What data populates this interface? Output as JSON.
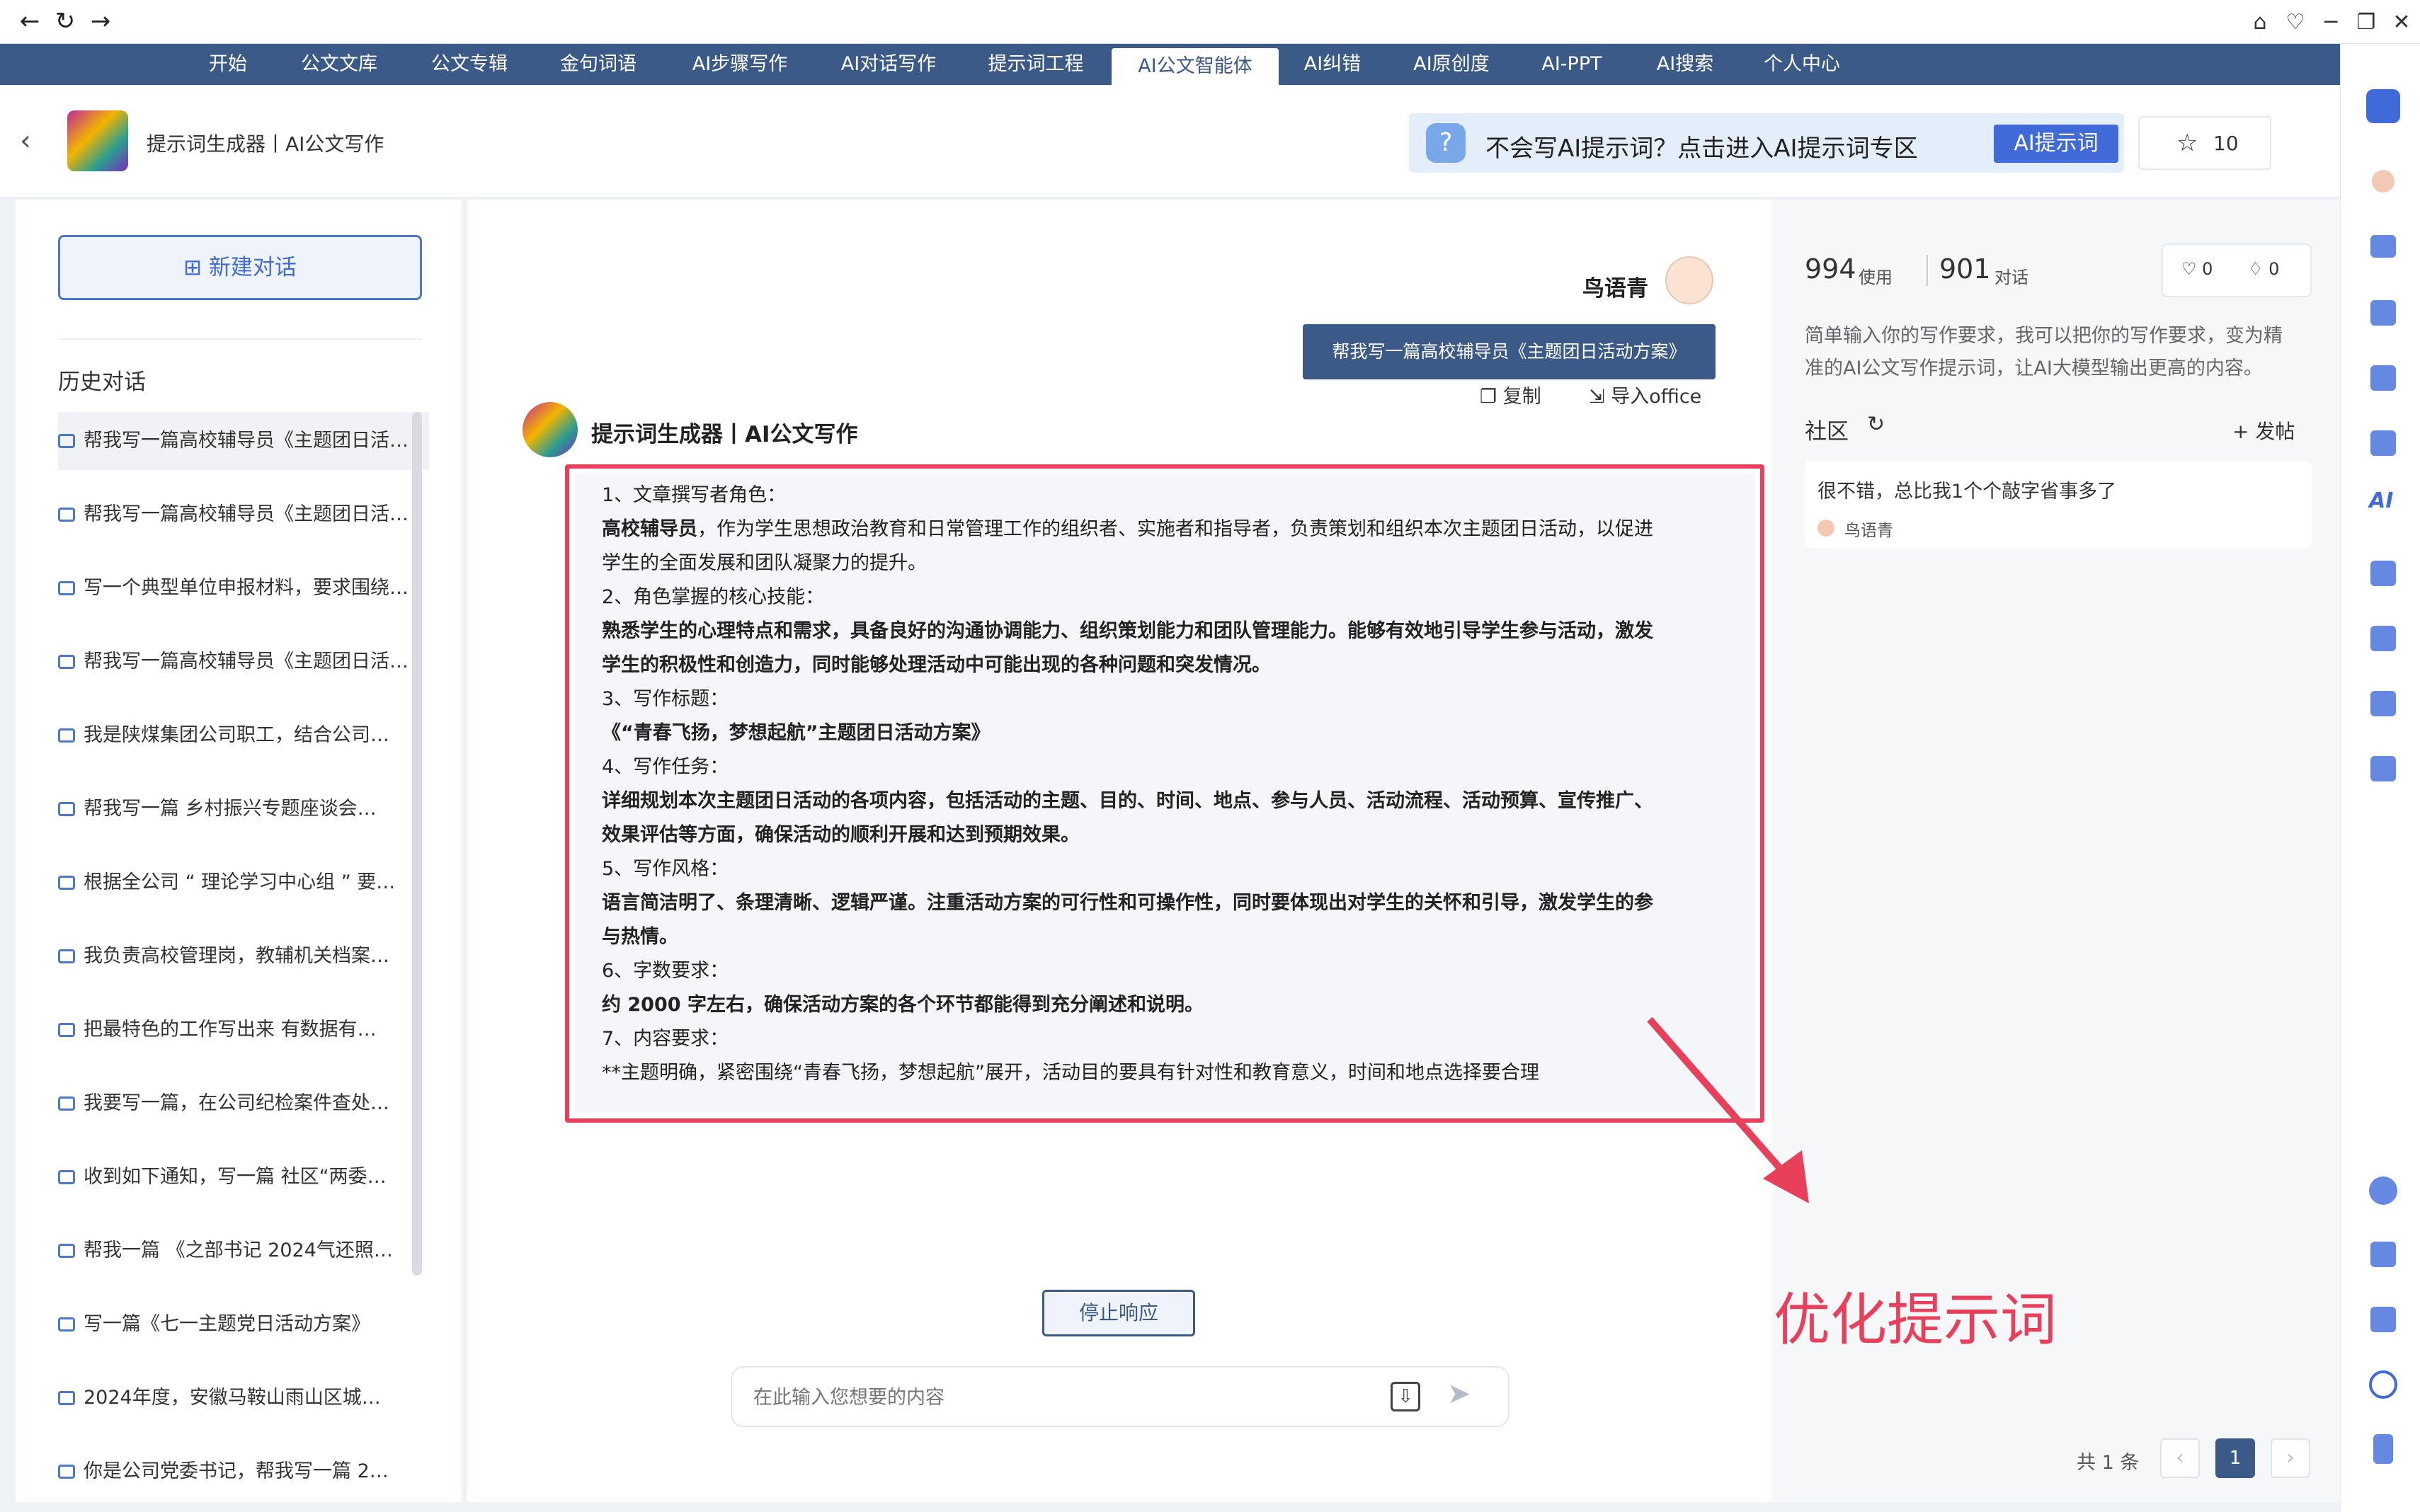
{
  "nav_tabs": [
    "开始",
    "公文文库",
    "公文专辑",
    "金句词语",
    "AI步骤写作",
    "AI对话写作",
    "提示词工程",
    "AI公文智能体",
    "AI纠错",
    "AI原创度",
    "AI-PPT",
    "AI搜索",
    "个人中心"
  ],
  "header": {
    "title": "提示词生成器丨AI公文写作",
    "banner_text": "不会写AI提示词？点击进入AI提示词专区",
    "banner_button": "AI提示词",
    "star_count": "10"
  },
  "left": {
    "new_chat": "新建对话",
    "history_title": "历史对话",
    "history": [
      "帮我写一篇高校辅导员《主题团日活动方案》",
      "帮我写一篇高校辅导员《主题团日活动方案》",
      "写一个典型单位申报材料，要求围绕…",
      "帮我写一篇高校辅导员《主题团日活动方案》",
      "我是陕煤集团公司职工，结合公司…",
      "帮我写一篇 乡村振兴专题座谈会…",
      "根据全公司 “ 理论学习中心组 ” 要…",
      "我负责高校管理岗，教辅机关档案…",
      "把最特色的工作写出来 有数据有…",
      "我要写一篇，在公司纪检案件查处…",
      "收到如下通知，写一篇 社区“两委…",
      "帮我一篇 《之部书记 2024气还照…",
      "写一篇《七一主题党日活动方案》",
      "2024年度，安徽马鞍山雨山区城…",
      "你是公司党委书记，帮我写一篇 2…"
    ]
  },
  "chat": {
    "user_name": "鸟语青",
    "user_message": "帮我写一篇高校辅导员《主题团日活动方案》",
    "copy": "复制",
    "import_office": "导入office",
    "bot_name": "提示词生成器丨AI公文写作",
    "lines": [
      "1、文章撰写者角色：",
      "高校辅导员",
      "，作为学生思想政治教育和日常管理工作的组织者、实施者和指导者，负责策划和组织本次主题团日活动，以促进",
      "学生的全面发展和团队凝聚力的提升。",
      "2、角色掌握的核心技能：",
      "熟悉学生的心理特点和需求，具备良好的沟通协调能力、组织策划能力和团队管理能力。能够有效地引导学生参与活动，激发",
      "学生的积极性和创造力，同时能够处理活动中可能出现的各种问题和突发情况。",
      "3、写作标题：",
      "《“青春飞扬，梦想起航”主题团日活动方案》",
      "4、写作任务：",
      "详细规划本次主题团日活动的各项内容，包括活动的主题、目的、时间、地点、参与人员、活动流程、活动预算、宣传推广、",
      "效果评估等方面，确保活动的顺利开展和达到预期效果。",
      "5、写作风格：",
      "语言简洁明了、条理清晰、逻辑严谨。注重活动方案的可行性和可操作性，同时要体现出对学生的关怀和引导，激发学生的参",
      "与热情。",
      "6、字数要求：",
      "约 2000 字左右，确保活动方案的各个环节都能得到充分阐述和说明。",
      "7、内容要求：",
      "**主题明确，紧密围绕“青春飞扬，梦想起航”展开，活动目的要具有针对性和教育意义，时间和地点选择要合理"
    ],
    "stop_button": "停止响应",
    "input_placeholder": "在此输入您想要的内容"
  },
  "right": {
    "usage_count": "994",
    "usage_label": "使用",
    "dialog_count": "901",
    "dialog_label": "对话",
    "like_count": "0",
    "dislike_count": "0",
    "description_1": "简单输入你的写作要求，我可以把你的写作要求，变为精",
    "description_2": "准的AI公文写作提示词，让AI大模型输出更高的内容。",
    "community_title": "社区",
    "post_button": "+ 发帖",
    "comment_text": "很不错，总比我1个个敲字省事多了",
    "comment_user": "鸟语青",
    "total": "共 1 条",
    "page": "1"
  },
  "annotation": "优化提示词",
  "colors": {
    "nav": "#3c5a87",
    "accent": "#3f6ad8",
    "highlight_box": "#e8405a"
  }
}
